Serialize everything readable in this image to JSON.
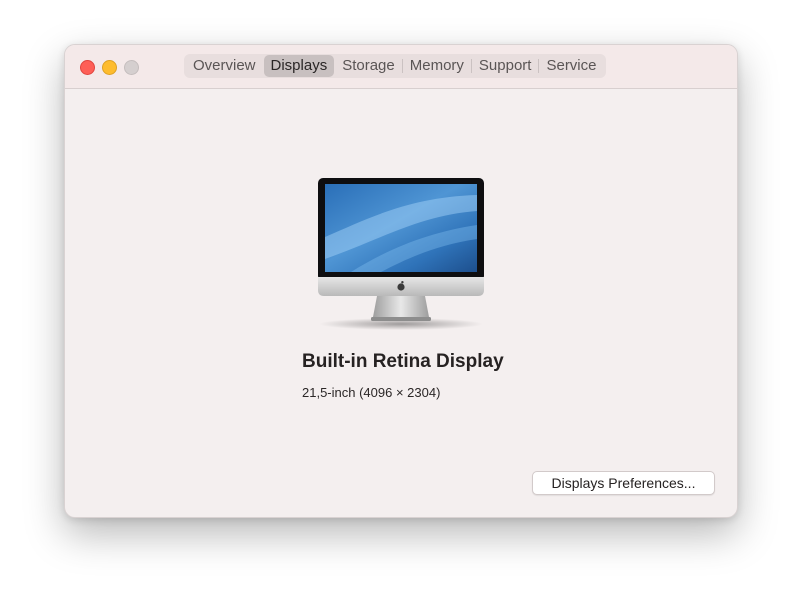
{
  "window": {
    "traffic_lights": {
      "close": "close-button",
      "minimize": "minimize-button",
      "zoom": "zoom-button-disabled"
    }
  },
  "tabs": [
    {
      "label": "Overview",
      "selected": false
    },
    {
      "label": "Displays",
      "selected": true
    },
    {
      "label": "Storage",
      "selected": false
    },
    {
      "label": "Memory",
      "selected": false
    },
    {
      "label": "Support",
      "selected": false
    },
    {
      "label": "Service",
      "selected": false
    }
  ],
  "display": {
    "name": "Built-in Retina Display",
    "spec": "21,5-inch (4096 × 2304)",
    "image": "imac-display-icon"
  },
  "buttons": {
    "preferences": "Displays Preferences..."
  },
  "colors": {
    "close": "#fe5f57",
    "minimize": "#febc2e",
    "zoom_inactive": "#d5cfcf",
    "window_bg": "#f4efef",
    "selected_tab": "#c8c0c0"
  }
}
